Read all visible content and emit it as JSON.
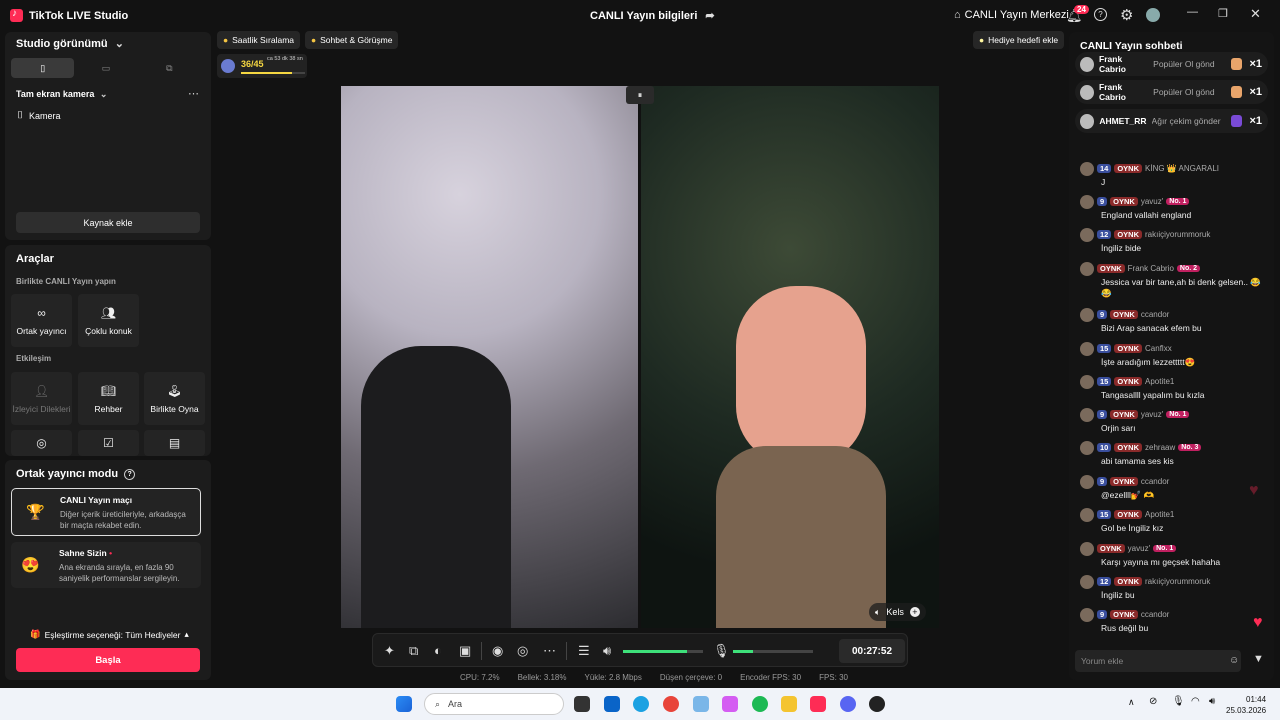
{
  "titlebar": {
    "app_title": "TikTok LIVE Studio",
    "center_title": "CANLI Yayın bilgileri",
    "live_center": "CANLI Yayın Merkezi",
    "notif_count": "24"
  },
  "left": {
    "studio_view": "Studio görünümü",
    "camera_section": "Tam ekran kamera",
    "camera_source": "Kamera",
    "add_source": "Kaynak ekle",
    "tools_title": "Araçlar",
    "together_title": "Birlikte CANLI Yayın yapın",
    "tiles_together": [
      "Ortak yayıncı",
      "Çoklu konuk"
    ],
    "interaction_title": "Etkileşim",
    "tiles_interaction": [
      "İzleyici Dilekleri",
      "Rehber",
      "Birlikte Oyna"
    ],
    "cohost_mode_title": "Ortak yayıncı modu",
    "modes": [
      {
        "title": "CANLI Yayın maçı",
        "desc": "Diğer içerik üreticileriyle, arkadaşça bir maçta rekabet edin."
      },
      {
        "title": "Sahne Sizin",
        "desc": "Ana ekranda sırayla, en fazla 90 saniyelik performanslar sergileyin."
      }
    ],
    "match_option": "Eşleştirme seçeneği: Tüm Hediyeler",
    "start_button": "Başla"
  },
  "top_pills": {
    "hourly": "Saatlik Sıralama",
    "chat": "Sohbet & Görüşme",
    "gift_goal": "Hediye hedefi ekle",
    "progress_text": "36/45",
    "progress_time": "ca 53 dk 38 sn",
    "progress_fraction": 0.8
  },
  "video": {
    "right_label": "Kels"
  },
  "toolbar": {
    "timer": "00:27:52",
    "volume_level": 0.8,
    "mic_level": 0.25
  },
  "stats": [
    "CPU:  7.2%",
    "Bellek:  3.18%",
    "Yükle:  2.8 Mbps",
    "Düşen çerçeve:  0",
    "Encoder FPS:  30",
    "FPS:  30"
  ],
  "chat": {
    "title": "CANLI Yayın sohbeti",
    "gifts": [
      {
        "name": "Frank Cabrio",
        "text": "Popüler Ol gönd",
        "count": "×1"
      },
      {
        "name": "Frank Cabrio",
        "text": "Popüler Ol gönd",
        "count": "×1"
      },
      {
        "name": "AHMET_RR",
        "text": "Ağır çekim gönder",
        "count": "×1"
      }
    ],
    "messages": [
      {
        "lvl": "14",
        "oy": "OYNK",
        "user": "KİNG 👑 ANGARALI",
        "rank": "",
        "text": "J"
      },
      {
        "lvl": "9",
        "oy": "OYNK",
        "user": "yavuz'",
        "rank": "No. 1",
        "text": "England vallahi england"
      },
      {
        "lvl": "12",
        "oy": "OYNK",
        "user": "rakıiçiyorummoruk",
        "rank": "",
        "text": "İngiliz bide"
      },
      {
        "lvl": "",
        "oy": "OYNK",
        "user": "Frank Cabrio",
        "rank": "No. 2",
        "text": "Jessica var bir tane,ah bi denk gelsen.. 😂 😂"
      },
      {
        "lvl": "9",
        "oy": "OYNK",
        "user": "ccandor",
        "rank": "",
        "text": "Bizi Arap sanacak efem bu"
      },
      {
        "lvl": "15",
        "oy": "OYNK",
        "user": "Canflxx",
        "rank": "",
        "text": "İşte aradığım lezzettttt😍"
      },
      {
        "lvl": "15",
        "oy": "OYNK",
        "user": "Apotite1",
        "rank": "",
        "text": "Tangasallll yapalım bu kızla"
      },
      {
        "lvl": "9",
        "oy": "OYNK",
        "user": "yavuz'",
        "rank": "No. 1",
        "text": "Orjin sarı"
      },
      {
        "lvl": "10",
        "oy": "OYNK",
        "user": "zehraaw",
        "rank": "No. 3",
        "text": "abi tamama ses kis"
      },
      {
        "lvl": "9",
        "oy": "OYNK",
        "user": "ccandor",
        "rank": "",
        "text": "@ezellll💅 🫶"
      },
      {
        "lvl": "15",
        "oy": "OYNK",
        "user": "Apotite1",
        "rank": "",
        "text": "Gol be İngiliz kız"
      },
      {
        "lvl": "",
        "oy": "OYNK",
        "user": "yavuz'",
        "rank": "No. 1",
        "text": "Karşı yayına mı geçsek hahaha"
      },
      {
        "lvl": "12",
        "oy": "OYNK",
        "user": "rakıiçiyorummoruk",
        "rank": "",
        "text": "İngiliz bu"
      },
      {
        "lvl": "9",
        "oy": "OYNK",
        "user": "ccandor",
        "rank": "",
        "text": "Rus değil bu"
      }
    ],
    "input_placeholder": "Yorum ekle"
  },
  "taskbar": {
    "search": "Ara",
    "time": "01:44",
    "date": "25.03.2026"
  }
}
